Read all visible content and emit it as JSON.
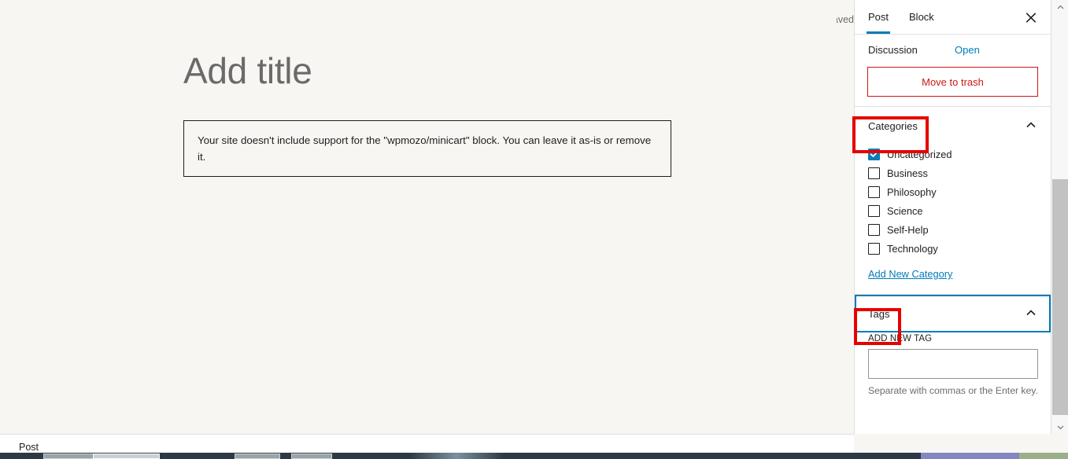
{
  "editor": {
    "title_placeholder": "Add title",
    "block_notice": "Your site doesn't include support for the \"wpmozo/minicart\" block. You can leave it as-is or remove it.",
    "breadcrumb": "Post"
  },
  "saved": {
    "label": "Saved",
    "check_icon": "✓"
  },
  "sidebar": {
    "tabs": [
      {
        "label": "Post",
        "active": true
      },
      {
        "label": "Block",
        "active": false
      }
    ],
    "close_label": "Close settings",
    "discussion": {
      "label": "Discussion",
      "value": "Open"
    },
    "move_to_trash": "Move to trash",
    "categories_panel": {
      "title": "Categories",
      "expanded": true,
      "items": [
        {
          "label": "Uncategorized",
          "checked": true
        },
        {
          "label": "Business",
          "checked": false
        },
        {
          "label": "Philosophy",
          "checked": false
        },
        {
          "label": "Science",
          "checked": false
        },
        {
          "label": "Self-Help",
          "checked": false
        },
        {
          "label": "Technology",
          "checked": false
        }
      ],
      "add_new_link": "Add New Category"
    },
    "tags_panel": {
      "title": "Tags",
      "expanded": true,
      "focused": true,
      "field_label": "ADD NEW TAG",
      "input_value": "",
      "input_placeholder": "",
      "help_text": "Separate with commas or the Enter key."
    }
  },
  "colors": {
    "accent_blue": "#007cba",
    "checkbox_blue": "#0a7cb8",
    "trash_red": "#cc1818",
    "annotation_red": "#e60000",
    "canvas_bg": "#f7f6f3",
    "taskbar": "#2b3a45"
  }
}
